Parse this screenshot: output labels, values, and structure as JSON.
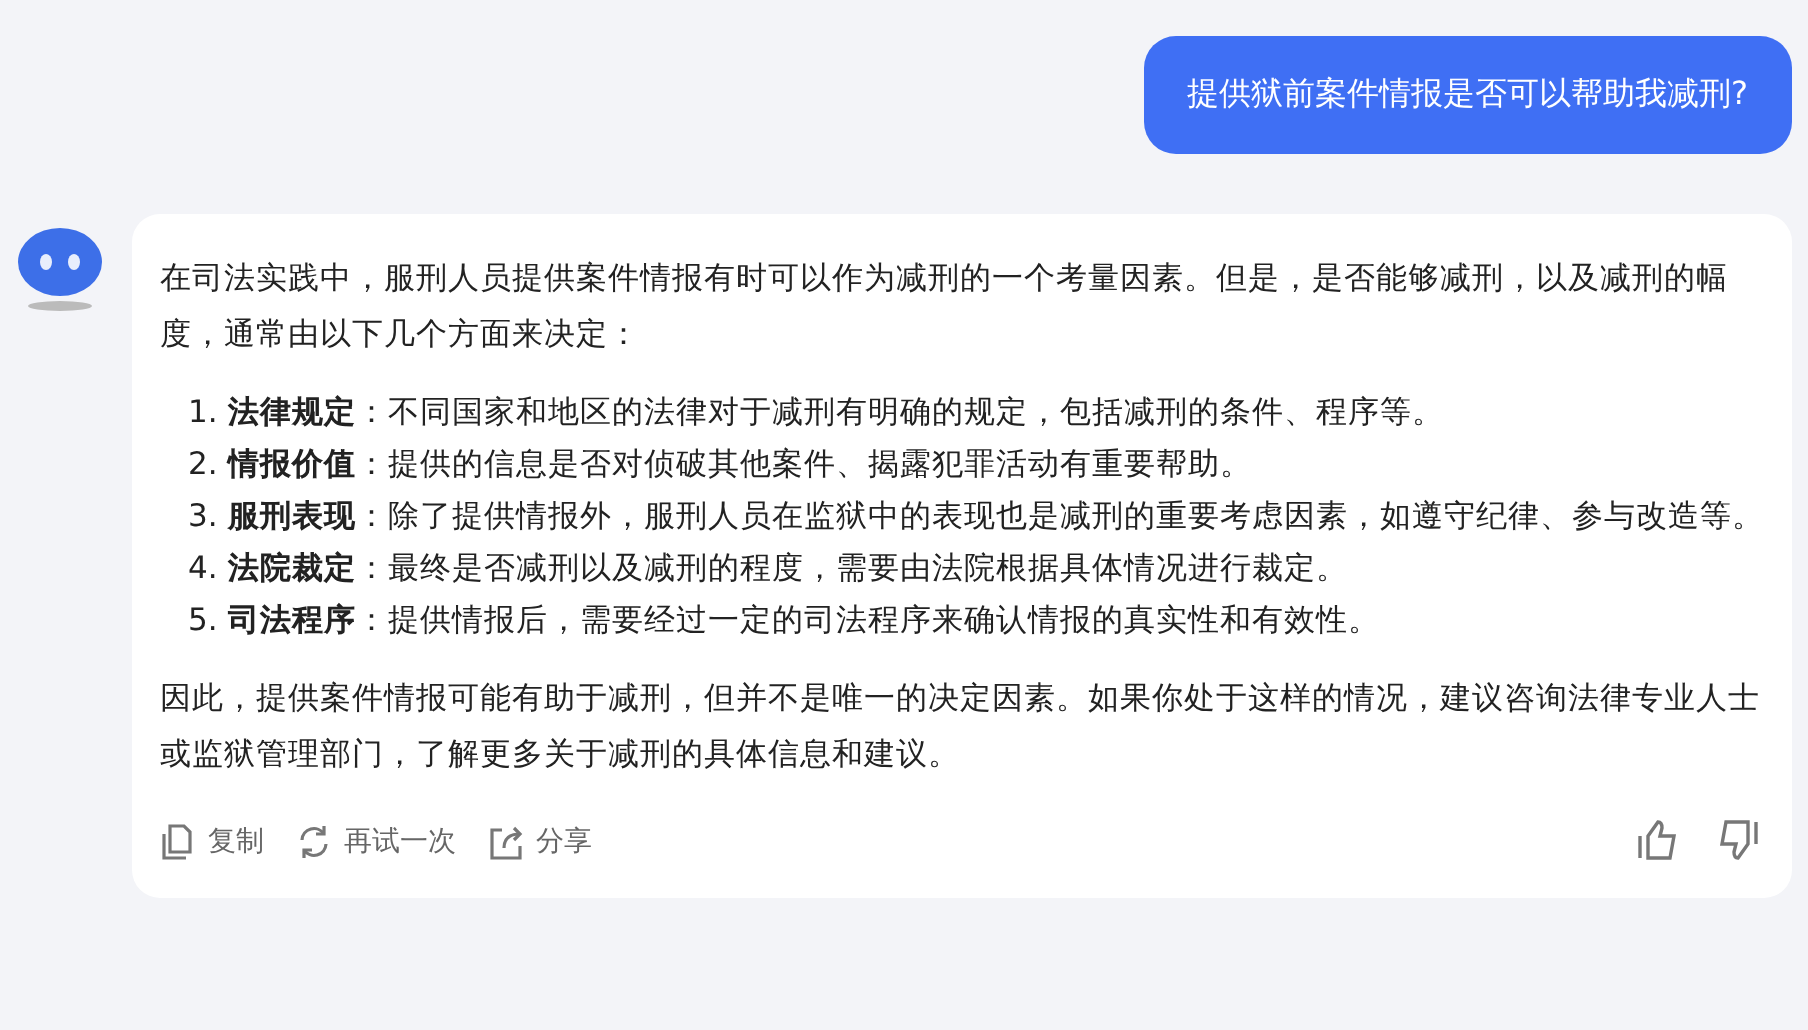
{
  "user_message": "提供狱前案件情报是否可以帮助我减刑?",
  "reply": {
    "intro": "在司法实践中，服刑人员提供案件情报有时可以作为减刑的一个考量因素。但是，是否能够减刑，以及减刑的幅度，通常由以下几个方面来决定：",
    "points": [
      {
        "number": "1.",
        "text": "**法律规定**：不同国家和地区的法律对于减刑有明确的规定，包括减刑的条件、程序等。"
      },
      {
        "number": "2.",
        "text": "**情报价值**：提供的信息是否对侦破其他案件、揭露犯罪活动有重要帮助。"
      },
      {
        "number": "3.",
        "text": "**服刑表现**：除了提供情报外，服刑人员在监狱中的表现也是减刑的重要考虑因素，如遵守纪律、参与改造等。"
      },
      {
        "number": "4.",
        "text": "**法院裁定**：最终是否减刑以及减刑的程度，需要由法院根据具体情况进行裁定。"
      },
      {
        "number": "5.",
        "text": "**司法程序**：提供情报后，需要经过一定的司法程序来确认情报的真实性和有效性。"
      }
    ],
    "conclusion": "因此，提供案件情报可能有助于减刑，但并不是唯一的决定因素。如果你处于这样的情况，建议咨询法律专业人士或监狱管理部门，了解更多关于减刑的具体信息和建议。",
    "actions": [
      {
        "kind": "copy",
        "label": "复制"
      },
      {
        "kind": "retry",
        "label": "再试一次"
      },
      {
        "kind": "share",
        "label": "分享"
      }
    ]
  }
}
